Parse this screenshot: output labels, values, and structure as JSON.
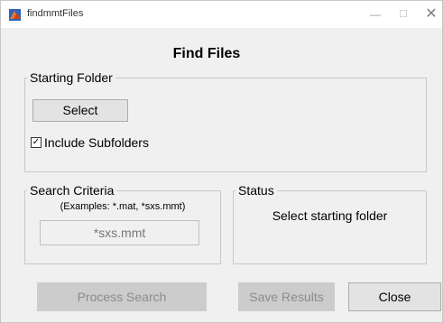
{
  "window": {
    "title": "findmmtFiles",
    "app_icon": "matlab-icon",
    "controls": {
      "minimize": "—",
      "maximize": "☐",
      "close": "✕"
    }
  },
  "heading": "Find Files",
  "starting_folder": {
    "legend": "Starting Folder",
    "select_label": "Select",
    "include_subfolders_label": "Include Subfolders",
    "include_subfolders_checked": true,
    "check_glyph": "✓"
  },
  "search_criteria": {
    "legend": "Search Criteria",
    "examples": "(Examples: *.mat, *sxs.mmt)",
    "value": "*sxs.mmt"
  },
  "status": {
    "legend": "Status",
    "message": "Select starting folder"
  },
  "actions": {
    "process_label": "Process Search",
    "save_label": "Save Results",
    "close_label": "Close"
  }
}
